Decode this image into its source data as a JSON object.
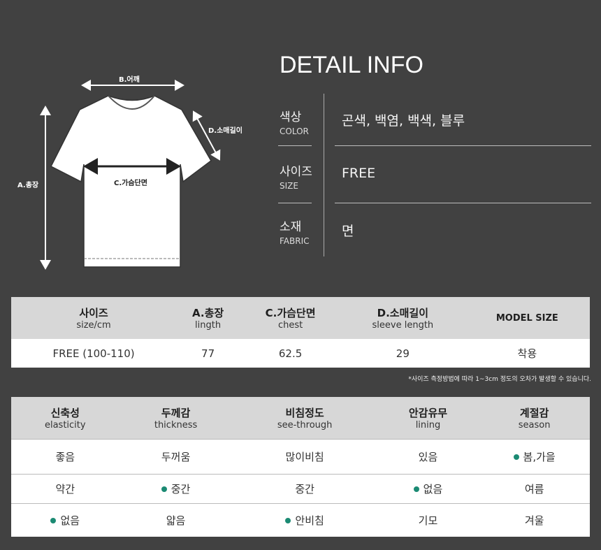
{
  "diagram": {
    "shoulder": "B.어깨",
    "sleeve": "D.소매길이",
    "length": "A.총장",
    "chest": "C.가슴단면"
  },
  "detail": {
    "title": "DETAIL INFO",
    "rows": [
      {
        "ko": "색상",
        "en": "COLOR",
        "value": "곤색, 백염, 백색, 블루"
      },
      {
        "ko": "사이즈",
        "en": "SIZE",
        "value": "FREE"
      },
      {
        "ko": "소재",
        "en": "FABRIC",
        "value": "면"
      }
    ]
  },
  "size_table": {
    "headers": [
      {
        "ko": "사이즈",
        "en": "size/cm"
      },
      {
        "ko": "A.총장",
        "en": "lingth"
      },
      {
        "ko": "C.가슴단면",
        "en": "chest"
      },
      {
        "ko": "D.소매길이",
        "en": "sleeve length"
      },
      {
        "ko": "MODEL SIZE",
        "en": ""
      }
    ],
    "row": [
      "FREE (100-110)",
      "77",
      "62.5",
      "29",
      "착용"
    ]
  },
  "note": "*사이즈 측정방법에 따라 1~3cm 정도의 오차가 발생할 수 있습니다.",
  "feature_table": {
    "headers": [
      {
        "ko": "신축성",
        "en": "elasticity"
      },
      {
        "ko": "두께감",
        "en": "thickness"
      },
      {
        "ko": "비침정도",
        "en": "see-through"
      },
      {
        "ko": "안감유무",
        "en": "lining"
      },
      {
        "ko": "계절감",
        "en": "season"
      }
    ],
    "rows": [
      [
        "좋음",
        "두꺼움",
        "많이비침",
        "있음",
        "봄,가을"
      ],
      [
        "약간",
        "중간",
        "중간",
        "없음",
        "여름"
      ],
      [
        "없음",
        "얇음",
        "안비침",
        "기모",
        "겨울"
      ]
    ],
    "selected": [
      [
        false,
        false,
        false,
        false,
        true
      ],
      [
        false,
        true,
        false,
        true,
        false
      ],
      [
        true,
        false,
        true,
        false,
        false
      ]
    ],
    "marker_color": "#1b8a73"
  }
}
